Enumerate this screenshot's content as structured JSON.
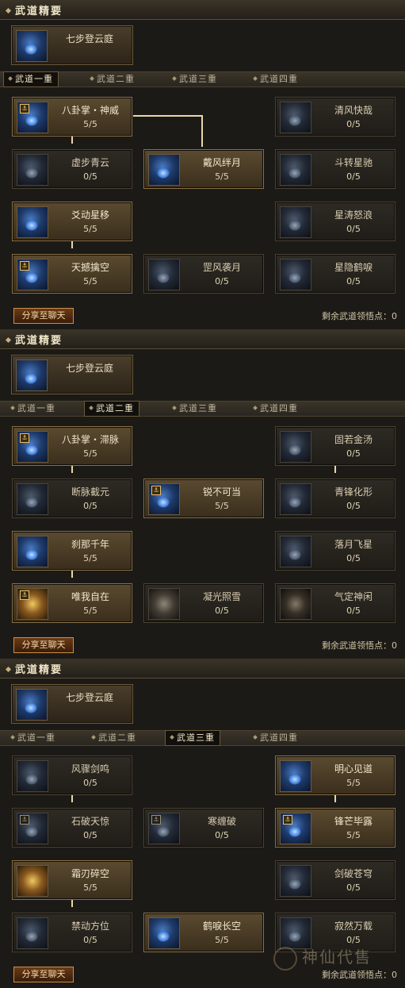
{
  "panels": [
    {
      "header": "武道精要",
      "essence": {
        "name": "七步登云庭"
      },
      "tabs": [
        "武道一重",
        "武道二重",
        "武道三重",
        "武道四重"
      ],
      "active_tab": 0,
      "skills": [
        {
          "name": "八卦掌・神威",
          "level": "5/5",
          "lit": true
        },
        {
          "name": "清风快哉",
          "level": "0/5",
          "lit": false
        },
        {
          "name": "虚步青云",
          "level": "0/5",
          "lit": false
        },
        {
          "name": "戴风绊月",
          "level": "5/5",
          "lit": true
        },
        {
          "name": "斗转星驰",
          "level": "0/5",
          "lit": false
        },
        {
          "name": "爻动星移",
          "level": "5/5",
          "lit": true
        },
        {
          "name": "星涛怒浪",
          "level": "0/5",
          "lit": false
        },
        {
          "name": "天撼擒空",
          "level": "5/5",
          "lit": true
        },
        {
          "name": "罡风袭月",
          "level": "0/5",
          "lit": false
        },
        {
          "name": "星隐鹤唳",
          "level": "0/5",
          "lit": false
        }
      ],
      "share_label": "分享至聊天",
      "remain_label": "剩余武道领悟点：",
      "remain_value": "0"
    },
    {
      "header": "武道精要",
      "essence": {
        "name": "七步登云庭"
      },
      "tabs": [
        "武道一重",
        "武道二重",
        "武道三重",
        "武道四重"
      ],
      "active_tab": 1,
      "skills": [
        {
          "name": "八卦掌・滞脉",
          "level": "5/5",
          "lit": true
        },
        {
          "name": "固若金汤",
          "level": "0/5",
          "lit": false
        },
        {
          "name": "断脉截元",
          "level": "0/5",
          "lit": false
        },
        {
          "name": "锐不可当",
          "level": "5/5",
          "lit": true
        },
        {
          "name": "青锋化形",
          "level": "0/5",
          "lit": false
        },
        {
          "name": "刹那千年",
          "level": "5/5",
          "lit": true
        },
        {
          "name": "落月飞星",
          "level": "0/5",
          "lit": false
        },
        {
          "name": "唯我自在",
          "level": "5/5",
          "lit": true
        },
        {
          "name": "凝光照雪",
          "level": "0/5",
          "lit": false
        },
        {
          "name": "气定神闲",
          "level": "0/5",
          "lit": false
        }
      ],
      "share_label": "分享至聊天",
      "remain_label": "剩余武道领悟点：",
      "remain_value": "0"
    },
    {
      "header": "武道精要",
      "essence": {
        "name": "七步登云庭"
      },
      "tabs": [
        "武道一重",
        "武道二重",
        "武道三重",
        "武道四重"
      ],
      "active_tab": 2,
      "skills": [
        {
          "name": "风骤剑鸣",
          "level": "0/5",
          "lit": false
        },
        {
          "name": "明心见道",
          "level": "5/5",
          "lit": true
        },
        {
          "name": "石破天惊",
          "level": "0/5",
          "lit": false
        },
        {
          "name": "寒缠破",
          "level": "0/5",
          "lit": false
        },
        {
          "name": "锋芒毕露",
          "level": "5/5",
          "lit": true
        },
        {
          "name": "霜刃碎空",
          "level": "5/5",
          "lit": true
        },
        {
          "name": "剑破苍穹",
          "level": "0/5",
          "lit": false
        },
        {
          "name": "禁动方位",
          "level": "0/5",
          "lit": false
        },
        {
          "name": "鹤唳长空",
          "level": "5/5",
          "lit": true
        },
        {
          "name": "寂然万载",
          "level": "0/5",
          "lit": false
        }
      ],
      "share_label": "分享至聊天",
      "remain_label": "剩余武道领悟点：",
      "remain_value": "0"
    }
  ],
  "watermark": "神仙代售"
}
